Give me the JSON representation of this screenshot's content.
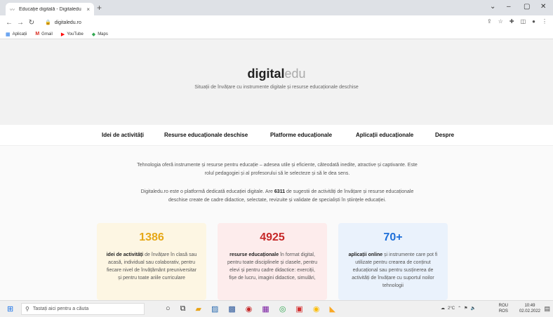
{
  "browser": {
    "tab_title": "Educație digitală - Digitaledu",
    "tab_close": "×",
    "new_tab": "+",
    "url": "digitaledu.ro",
    "bookmarks": [
      {
        "label": "Aplicații",
        "icon": "apps-grid-icon"
      },
      {
        "label": "Gmail",
        "icon": "gmail-icon"
      },
      {
        "label": "YouTube",
        "icon": "youtube-icon"
      },
      {
        "label": "Maps",
        "icon": "maps-icon"
      }
    ]
  },
  "site": {
    "logo_main": "digital",
    "logo_light": "edu",
    "tagline": "Situații de învățare cu instrumente digitale și resurse educaționale deschise",
    "menu": [
      "Idei de activități",
      "Resurse educaționale deschise",
      "Platforme educaționale",
      "Aplicații educaționale",
      "Despre"
    ],
    "intro_line1": "Tehnologia oferă instrumente și resurse pentru educație – adesea utile și eficiente, câteodată inedite, atractive și captivante. Este",
    "intro_line2": "rolul pedagogiei și al profesorului să le selecteze și să le dea sens.",
    "about_pre": "Digitaledu.ro este o platformă dedicată educației digitale. Are ",
    "about_count": "6311",
    "about_post": " de sugestii de activități de învățare și resurse educaționale",
    "about_line2": "deschise create de cadre didactice, selectate, revizuite și validate de specialiști în științele educației.",
    "cards": [
      {
        "number": "1386",
        "bold": "idei de activități",
        "text": " de învățare în clasă sau acasă, individual sau colaborativ, pentru fiecare nivel de învățământ preuniversitar și pentru toate ariile curriculare",
        "color": "#e6a817",
        "bg": "#fdf6e3"
      },
      {
        "number": "4925",
        "bold": "resurse educaționale",
        "text": " în format digital, pentru toate disciplinele și clasele, pentru elevi și pentru cadre didactice: exerciții, fișe de lucru, imagini didactice, simulări,",
        "color": "#c62828",
        "bg": "#fdecec"
      },
      {
        "number": "70+",
        "bold": "aplicații online",
        "text": " și instrumente care pot fi utilizate pentru crearea de conținut educațional sau pentru susținerea de activități de învățare cu suportul noilor tehnologii",
        "color": "#1e6fd9",
        "bg": "#eaf2fc"
      }
    ]
  },
  "taskbar": {
    "search_placeholder": "Tastați aici pentru a căuta",
    "weather": "2°C",
    "lang_top": "ROU",
    "lang_bottom": "ROS",
    "time": "10:49",
    "date": "02.02.2022"
  }
}
